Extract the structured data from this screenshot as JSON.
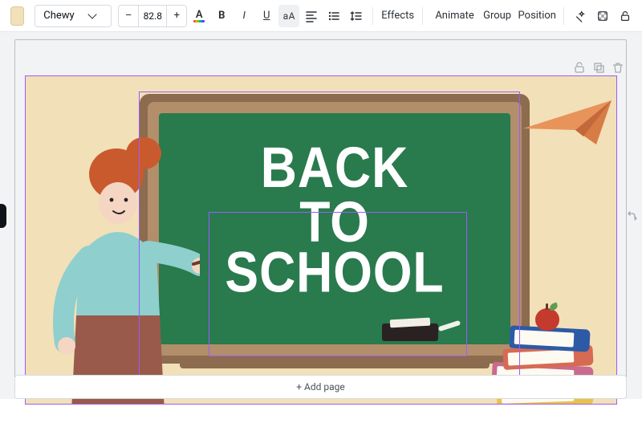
{
  "toolbar": {
    "swatch_color": "#f2e0b8",
    "font_name": "Chewy",
    "font_size": "82.8",
    "effects_label": "Effects",
    "animate_label": "Animate",
    "group_label": "Group",
    "position_label": "Position",
    "minus": "–",
    "plus": "+",
    "bold_glyph": "B",
    "italic_glyph": "I",
    "underline_glyph": "U",
    "case_glyph": "aA"
  },
  "canvas": {
    "background_color": "#f2e0b8",
    "chalkboard_text_line1": "BACK TO",
    "chalkboard_text_line2": "SCHOOL"
  },
  "footer": {
    "add_page_label": "+ Add page"
  },
  "icons": {
    "text_color": "A",
    "magic_wand": "magic-wand-icon",
    "transparency": "transparency-icon",
    "lock": "lock-icon",
    "align": "align-left-icon",
    "list": "list-icon",
    "spacing": "line-spacing-icon"
  }
}
